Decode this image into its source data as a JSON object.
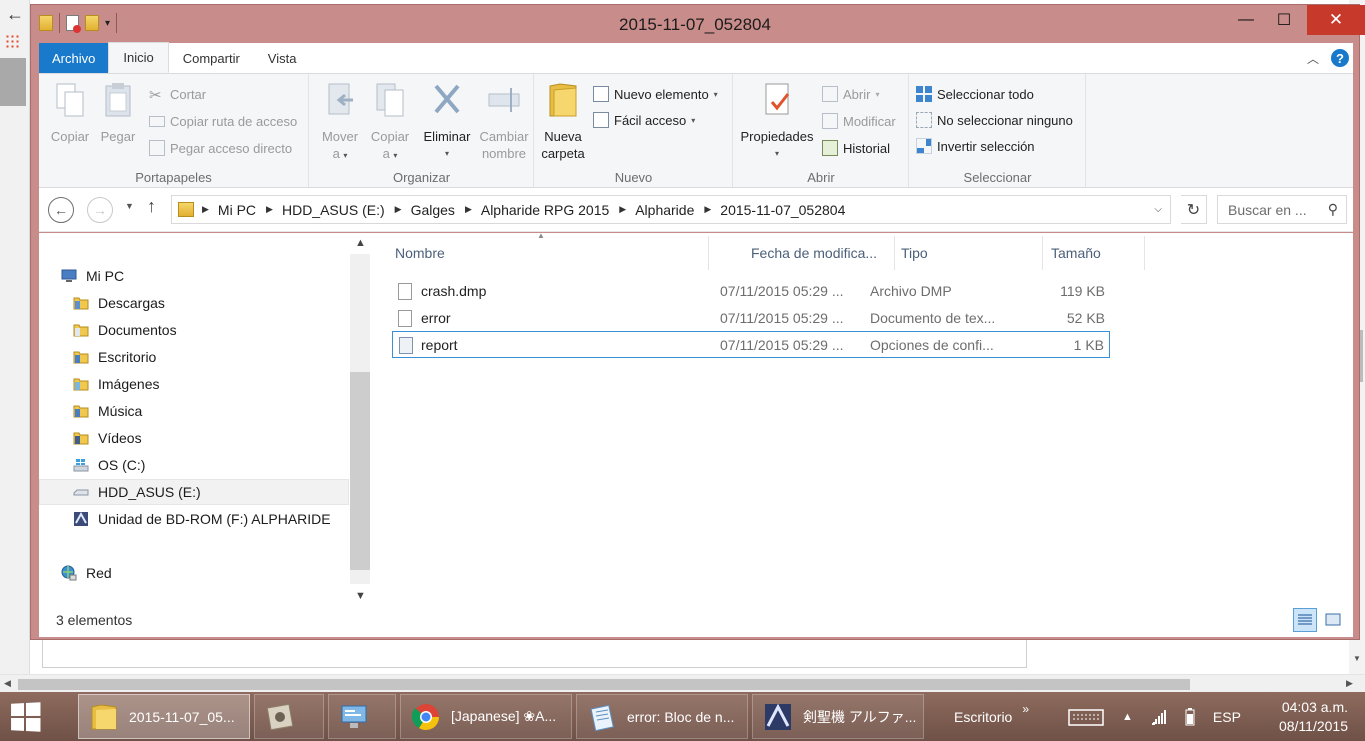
{
  "window": {
    "title": "2015-11-07_052804",
    "min": "—",
    "max": "☐",
    "close": "✕"
  },
  "ribbon_tabs": [
    "Archivo",
    "Inicio",
    "Compartir",
    "Vista"
  ],
  "ribbon": {
    "clipboard": {
      "label": "Portapapeles",
      "copiar": "Copiar",
      "pegar": "Pegar",
      "cortar": "Cortar",
      "copiar_ruta": "Copiar ruta de acceso",
      "pegar_acceso": "Pegar acceso directo"
    },
    "organize": {
      "label": "Organizar",
      "mover_1": "Mover",
      "mover_2": "a",
      "copiar_1": "Copiar",
      "copiar_2": "a",
      "eliminar": "Eliminar",
      "cambiar_1": "Cambiar",
      "cambiar_2": "nombre"
    },
    "new": {
      "label": "Nuevo",
      "nueva_1": "Nueva",
      "nueva_2": "carpeta",
      "nuevo_elemento": "Nuevo elemento",
      "facil_acceso": "Fácil acceso"
    },
    "open": {
      "label": "Abrir",
      "propiedades": "Propiedades",
      "abrir": "Abrir",
      "modificar": "Modificar",
      "historial": "Historial"
    },
    "select": {
      "label": "Seleccionar",
      "todo": "Seleccionar todo",
      "ninguno": "No seleccionar ninguno",
      "invertir": "Invertir selección"
    }
  },
  "address": {
    "crumbs": [
      "Mi PC",
      "HDD_ASUS (E:)",
      "Galges",
      "Alpharide RPG 2015",
      "Alpharide",
      "2015-11-07_052804"
    ],
    "search_placeholder": "Buscar en ..."
  },
  "nav": {
    "pc": "Mi PC",
    "items": [
      "Descargas",
      "Documentos",
      "Escritorio",
      "Imágenes",
      "Música",
      "Vídeos",
      "OS (C:)",
      "HDD_ASUS (E:)",
      "Unidad de BD-ROM (F:) ALPHARIDE"
    ],
    "network": "Red",
    "selected": "HDD_ASUS (E:)"
  },
  "columns": [
    "Nombre",
    "Fecha de modifica...",
    "Tipo",
    "Tamaño"
  ],
  "files": [
    {
      "name": "crash.dmp",
      "date": "07/11/2015 05:29 ...",
      "type": "Archivo DMP",
      "size": "119 KB"
    },
    {
      "name": "error",
      "date": "07/11/2015 05:29 ...",
      "type": "Documento de tex...",
      "size": "52 KB"
    },
    {
      "name": "report",
      "date": "07/11/2015 05:29 ...",
      "type": "Opciones de confi...",
      "size": "1 KB"
    }
  ],
  "status": {
    "count": "3 elementos"
  },
  "taskbar": {
    "items": [
      {
        "label": "2015-11-07_05...",
        "icon": "folder-icon"
      },
      {
        "label": "",
        "icon": "settings-app-icon"
      },
      {
        "label": "",
        "icon": "control-panel-icon"
      },
      {
        "label": "[Japanese] ❀A...",
        "icon": "chrome-icon"
      },
      {
        "label": "error: Bloc de n...",
        "icon": "notepad-icon"
      },
      {
        "label": "剣聖機 アルファ...",
        "icon": "game-icon"
      }
    ],
    "toolbar": "Escritorio",
    "chevron": "»",
    "lang": "ESP",
    "time": "04:03 a.m.",
    "date": "08/11/2015"
  },
  "colors": {
    "titlebar": "#c88d8a",
    "file_tab": "#1979ca",
    "close_button": "#c7392a",
    "selection": "#3a8fd6",
    "taskbar": "#7d5e52"
  }
}
